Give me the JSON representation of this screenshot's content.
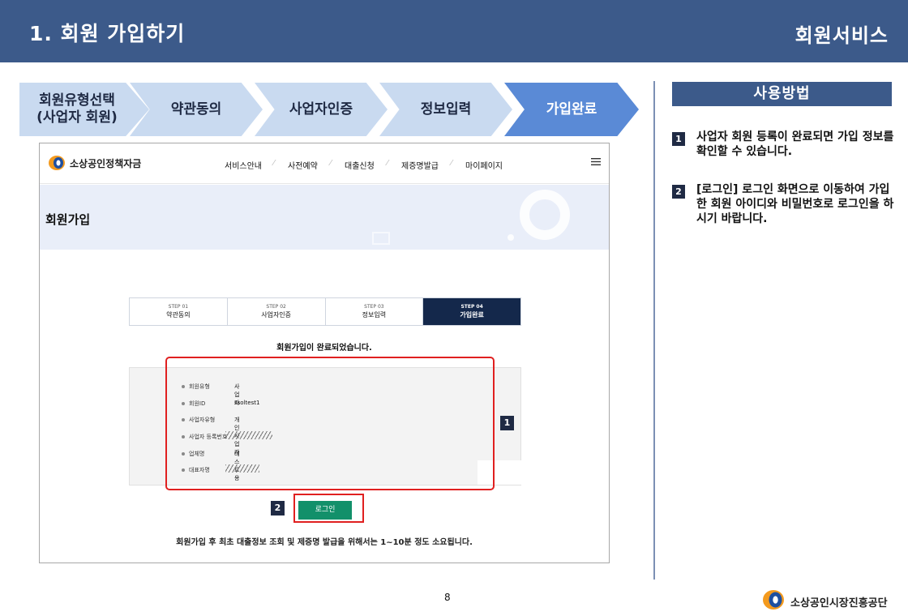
{
  "header": {
    "title": "1. 회원 가입하기",
    "section": "회원서비스"
  },
  "steps": [
    {
      "label": "회원유형선택\n(사업자 회원)",
      "active": false
    },
    {
      "label": "약관동의",
      "active": false
    },
    {
      "label": "사업자인증",
      "active": false
    },
    {
      "label": "정보입력",
      "active": false
    },
    {
      "label": "가입완료",
      "active": true
    }
  ],
  "usage": {
    "title": "사용방법",
    "tips": [
      {
        "number": "1",
        "text": "사업자 회원 등록이 완료되면 가입 정보를 확인할 수 있습니다."
      },
      {
        "number": "2",
        "text": "[로그인] 로그인 화면으로 이동하여 가입한 회원 아이디와 비밀번호로 로그인을 하시기 바랍니다."
      }
    ]
  },
  "screenshot": {
    "logo_text": "소상공인정책자금",
    "menu": [
      "서비스안내",
      "사전예약",
      "대출신청",
      "제증명발급",
      "마이페이지"
    ],
    "banner_title": "회원가입",
    "steps": [
      {
        "no": "STEP 01",
        "label": "약관동의"
      },
      {
        "no": "STEP 02",
        "label": "사업자인증"
      },
      {
        "no": "STEP 03",
        "label": "정보입력"
      },
      {
        "no": "STEP 04",
        "label": "가입완료"
      }
    ],
    "done_message": "회원가입이 완료되었습니다.",
    "info_rows": [
      {
        "label": "회원유형",
        "value": "사업자"
      },
      {
        "label": "회원ID",
        "value": "ssoltest1"
      },
      {
        "label": "사업자유형",
        "value": "개인사업자"
      },
      {
        "label": "사업자 등록번호",
        "value": ""
      },
      {
        "label": "업체명",
        "value": "테스트용"
      },
      {
        "label": "대표자명",
        "value": ""
      }
    ],
    "login_button": "로그인",
    "note": "회원가입 후 최초 대출정보 조회 및 제증명 발급을 위해서는 1~10분 정도 소요됩니다.",
    "badges": [
      "1",
      "2"
    ]
  },
  "footer": {
    "page_number": "8",
    "org_name": "소상공인시장진흥공단"
  },
  "colors": {
    "header_bg": "#3c5a8a",
    "step_bg": "#c9daf0",
    "step_active": "#5a8ad6",
    "dark_navy": "#14284b",
    "login_green": "#12906a",
    "highlight_red": "#e02020"
  }
}
